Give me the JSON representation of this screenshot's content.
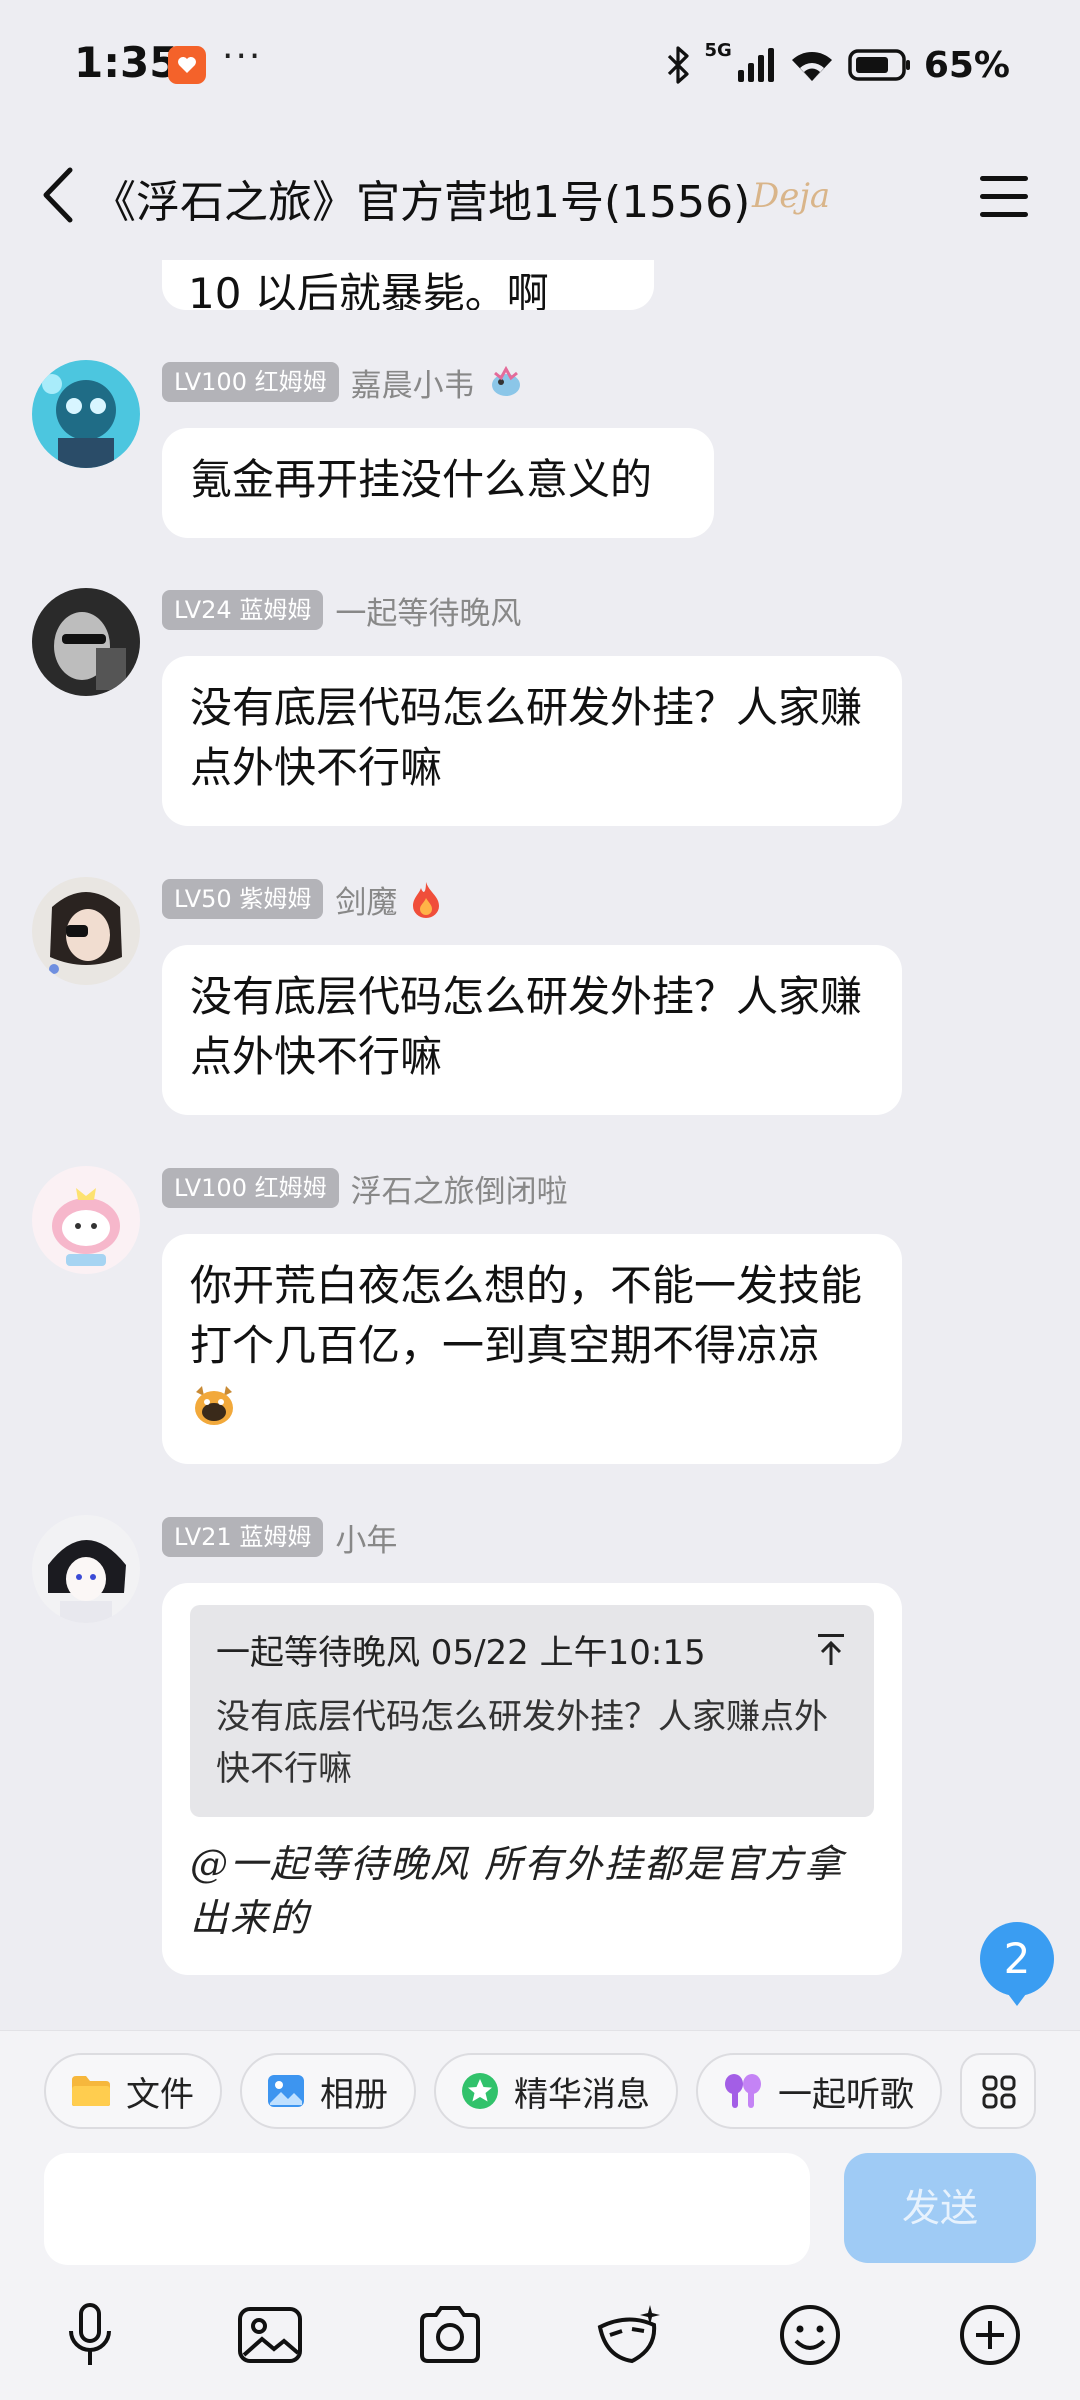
{
  "status_bar": {
    "time": "1:35",
    "dots": "···",
    "network": "5G",
    "battery": "65%"
  },
  "header": {
    "title": "《浮石之旅》官方营地1号(1556)",
    "tag": "Deja"
  },
  "partial_message": {
    "text": "10 以后就暴毙。啊"
  },
  "messages": [
    {
      "level": "LV100 红姆姆",
      "nickname": "嘉晨小韦",
      "text": "氪金再开挂没什么意义的"
    },
    {
      "level": "LV24 蓝姆姆",
      "nickname": "一起等待晚风",
      "text": "没有底层代码怎么研发外挂？人家赚点外快不行嘛"
    },
    {
      "level": "LV50 紫姆姆",
      "nickname": "剑魔",
      "text": "没有底层代码怎么研发外挂？人家赚点外快不行嘛"
    },
    {
      "level": "LV100 红姆姆",
      "nickname": "浮石之旅倒闭啦",
      "text": "你开荒白夜怎么想的，不能一发技能打个几百亿，一到真空期不得凉凉"
    },
    {
      "level": "LV21 蓝姆姆",
      "nickname": "小年",
      "quote_header": "一起等待晚风 05/22 上午10:15",
      "quote_text": "没有底层代码怎么研发外挂？人家赚点外快不行嘛",
      "text": "@一起等待晚风 所有外挂都是官方拿出来的"
    }
  ],
  "unread_count": "2",
  "chips": [
    {
      "label": "文件",
      "icon": "folder-icon"
    },
    {
      "label": "相册",
      "icon": "photo-album-icon"
    },
    {
      "label": "精华消息",
      "icon": "star-icon"
    },
    {
      "label": "一起听歌",
      "icon": "earbuds-icon"
    }
  ],
  "input": {
    "placeholder": ""
  },
  "send_label": "发送",
  "toolbar_icons": [
    "microphone-icon",
    "image-icon",
    "camera-icon",
    "sticker-icon",
    "emoji-icon",
    "plus-icon"
  ]
}
